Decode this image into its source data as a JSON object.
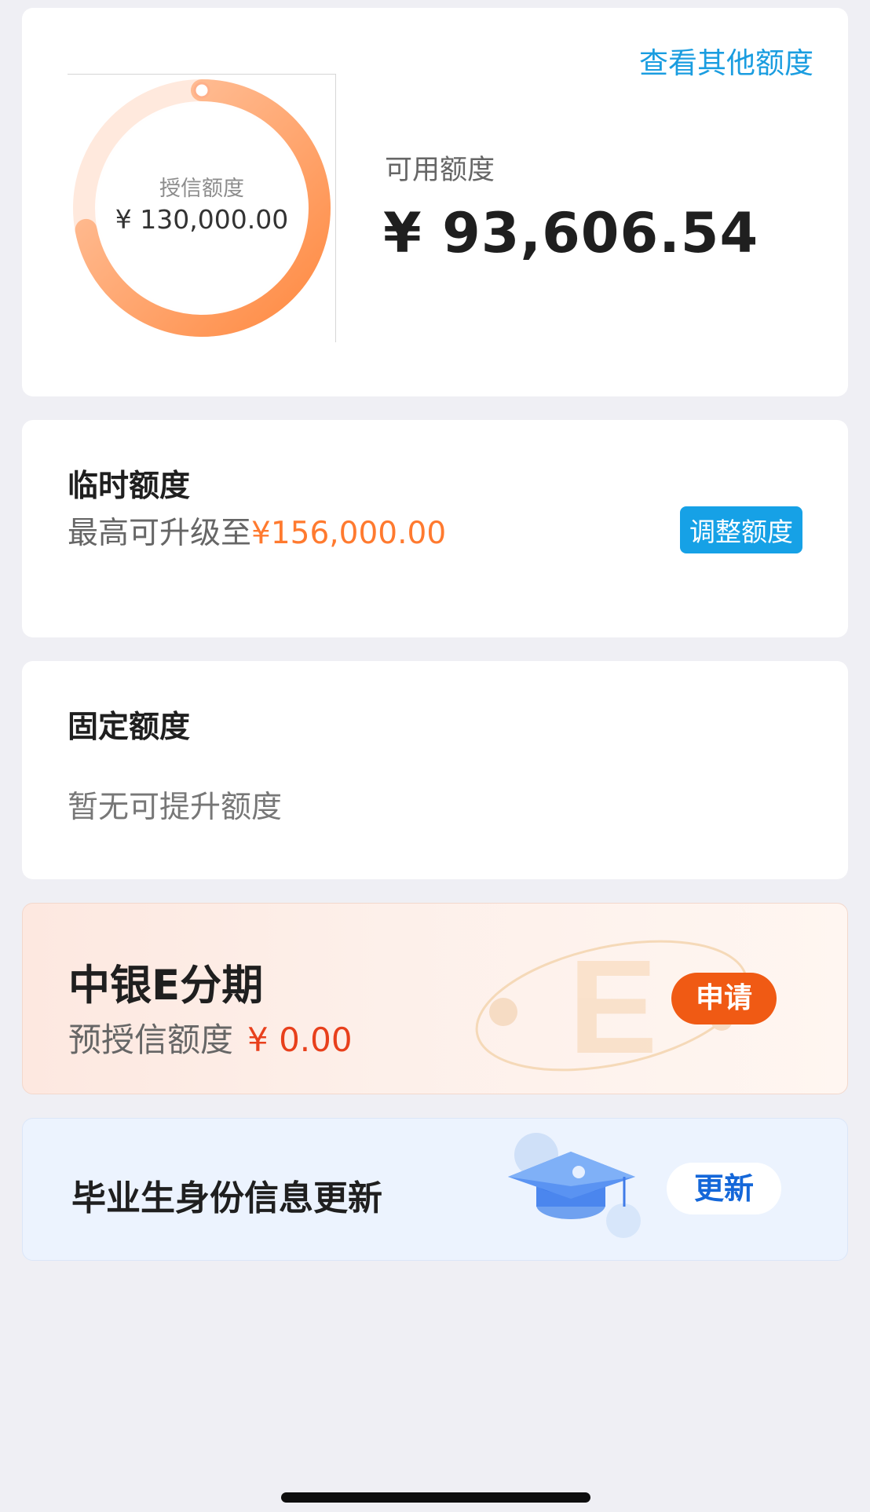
{
  "main_card": {
    "other_limits_link": "查看其他额度",
    "credit_label": "授信额度",
    "credit_amount": "¥ 130,000.00",
    "available_label": "可用额度",
    "available_amount": "¥ 93,606.54",
    "available_ratio": 0.72
  },
  "temp_card": {
    "title": "临时额度",
    "sub_prefix": "最高可升级至",
    "sub_amount": "¥156,000.00",
    "adjust_button": "调整额度"
  },
  "fixed_card": {
    "title": "固定额度",
    "sub": "暂无可提升额度"
  },
  "promo_card": {
    "title": "中银E分期",
    "sub_label": "预授信额度",
    "sub_amount": "¥ 0.00",
    "apply_button": "申请"
  },
  "graduate_card": {
    "title": "毕业生身份信息更新",
    "update_button": "更新"
  },
  "colors": {
    "accent_blue": "#16a1e6",
    "ring_orange": "#ff8f4a",
    "highlight_orange": "#ff7a2f",
    "promo_red": "#e8401c"
  }
}
